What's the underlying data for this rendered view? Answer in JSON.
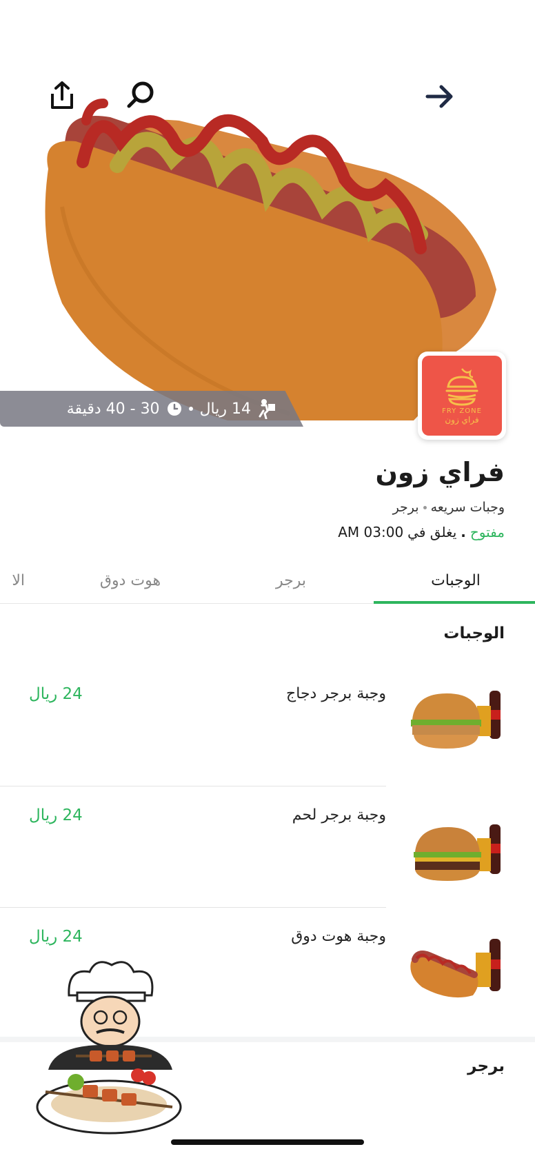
{
  "header": {
    "back_icon": "arrow-right-icon",
    "search_icon": "search-icon",
    "share_icon": "share-icon"
  },
  "delivery_strip": {
    "delivery_fee": "14 ريال",
    "delivery_time": "30 - 40 دقيقة"
  },
  "logo": {
    "text_en": "FRY ZONE",
    "text_ar": "فراي زون"
  },
  "store": {
    "name": "فراي زون",
    "categories": [
      "وجبات سريعه",
      "برجر"
    ],
    "status_open": "مفتوح",
    "status_closes": "يغلق في",
    "close_time": "03:00 AM"
  },
  "tabs": [
    {
      "label": "الوجبات",
      "active": true
    },
    {
      "label": "برجر",
      "active": false
    },
    {
      "label": "هوت دوق",
      "active": false
    },
    {
      "label": "الا",
      "active": false
    }
  ],
  "sections": {
    "meals_title": "الوجبات",
    "burger_title": "برجر"
  },
  "items": [
    {
      "name": "وجبة برجر دجاج",
      "price": "24 ريال"
    },
    {
      "name": "وجبة برجر لحم",
      "price": "24 ريال"
    },
    {
      "name": "وجبة هوت دوق",
      "price": "24 ريال"
    }
  ],
  "colors": {
    "accent": "#2db55d",
    "logo_bg": "#ee5548",
    "logo_fg": "#f6c04a"
  }
}
